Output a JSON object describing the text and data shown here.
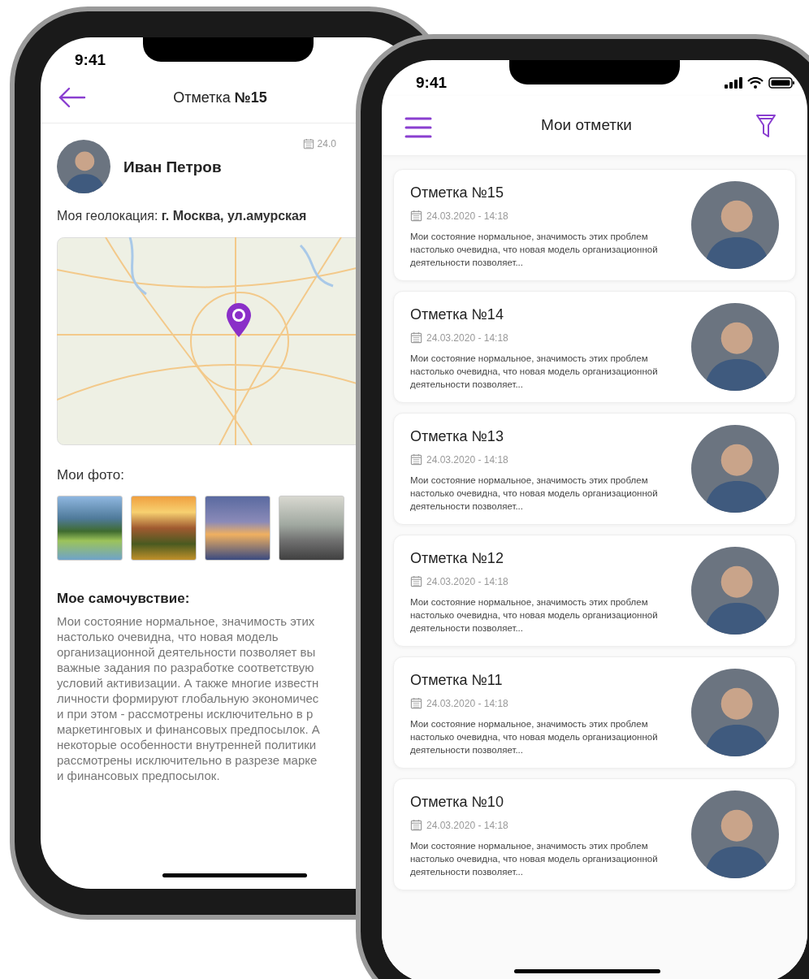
{
  "detail_screen": {
    "status_time": "9:41",
    "title": "Отметка **№15**",
    "author": {
      "name": "Иван Петров"
    },
    "date": "24.0",
    "geolocation": "Моя геолокация: **г. Москва, ул.амурская**",
    "photos_label": "Мои фото:",
    "photos": [
      {
        "kind": "lake"
      },
      {
        "kind": "sunset"
      },
      {
        "kind": "dolphins"
      },
      {
        "kind": "interior"
      }
    ],
    "wellbeing_title": "Мое самочувствие:",
    "wellbeing_lines": [
      "Мои состояние нормальное, значимость этих",
      "настолько очевидна, что новая модель",
      "организационной деятельности позволяет вы",
      "важные задания по разработке соответствую",
      "условий активизации. А также многие известн",
      "личности формируют глобальную экономичес",
      "и при этом - рассмотрены исключительно в р",
      "маркетинговых и финансовых предпосылок. А",
      "некоторые особенности внутренней политики",
      "рассмотрены исключительно в разрезе марке",
      "и финансовых предпосылок."
    ]
  },
  "list_screen": {
    "status_time": "9:41",
    "title": "Мои отметки",
    "entries": [
      {
        "title": "Отметка №15",
        "date": "24.03.2020 - 14:18",
        "text": "Мои состояние нормальное, значимость этих проблем настолько очевидна, что новая модель организационной деятельности позволяет..."
      },
      {
        "title": "Отметка №14",
        "date": "24.03.2020 - 14:18",
        "text": "Мои состояние нормальное, значимость этих проблем настолько очевидна, что новая модель организационной деятельности позволяет..."
      },
      {
        "title": "Отметка №13",
        "date": "24.03.2020 - 14:18",
        "text": "Мои состояние нормальное, значимость этих проблем настолько очевидна, что новая модель организационной деятельности позволяет..."
      },
      {
        "title": "Отметка №12",
        "date": "24.03.2020 - 14:18",
        "text": "Мои состояние нормальное, значимость этих проблем настолько очевидна, что новая модель организационной деятельности позволяет..."
      },
      {
        "title": "Отметка №11",
        "date": "24.03.2020 - 14:18",
        "text": "Мои состояние нормальное, значимость этих проблем настолько очевидна, что новая модель организационной деятельности позволяет..."
      },
      {
        "title": "Отметка №10",
        "date": "24.03.2020 - 14:18",
        "text": "Мои состояние нормальное, значимость этих проблем настолько очевидна, что новая модель организационной деятельности позволяет..."
      }
    ]
  }
}
